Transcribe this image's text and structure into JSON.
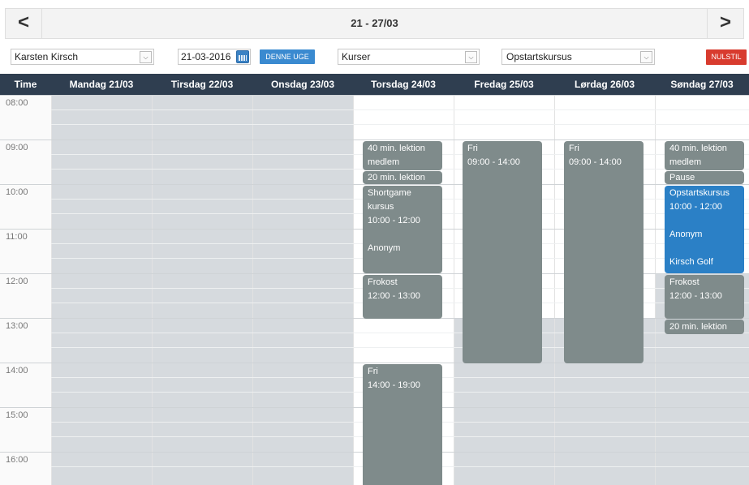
{
  "nav": {
    "prev": "<",
    "title": "21 - 27/03",
    "next": ">"
  },
  "filters": {
    "person": "Karsten Kirsch",
    "date": "21-03-2016",
    "this_week_button": "DENNE UGE",
    "category": "Kurser",
    "course": "Opstartskursus",
    "reset_button": "NULSTIL"
  },
  "columns": {
    "time": "Time",
    "days": [
      "Mandag 21/03",
      "Tirsdag 22/03",
      "Onsdag 23/03",
      "Torsdag 24/03",
      "Fredag 25/03",
      "Lørdag 26/03",
      "Søndag 27/03"
    ]
  },
  "times": [
    "08:00",
    "09:00",
    "10:00",
    "11:00",
    "12:00",
    "13:00",
    "14:00",
    "15:00",
    "16:00"
  ],
  "events": {
    "thu_40": [
      "40 min. lektion",
      "medlem"
    ],
    "thu_20": [
      "20 min. lektion"
    ],
    "thu_short": [
      "Shortgame",
      "kursus",
      "10:00 - 12:00",
      "",
      "Anonym"
    ],
    "thu_frokost": [
      "Frokost",
      "12:00 - 13:00"
    ],
    "thu_fri": [
      "Fri",
      "14:00 - 19:00"
    ],
    "fri_fri": [
      "Fri",
      "09:00 - 14:00"
    ],
    "sat_fri": [
      "Fri",
      "09:00 - 14:00"
    ],
    "sun_40": [
      "40 min. lektion",
      "medlem"
    ],
    "sun_pause": [
      "Pause"
    ],
    "sun_opstart": [
      "Opstartskursus",
      "10:00 - 12:00",
      "",
      "Anonym",
      "",
      "Kirsch Golf"
    ],
    "sun_frokost": [
      "Frokost",
      "12:00 - 13:00"
    ],
    "sun_20": [
      "20 min. lektion"
    ]
  },
  "colors": {
    "header": "#2f3e50",
    "event_gray": "#7f8b8b",
    "event_blue": "#2b80c6",
    "reset": "#d83b2e",
    "this_week": "#3a8ad0"
  }
}
